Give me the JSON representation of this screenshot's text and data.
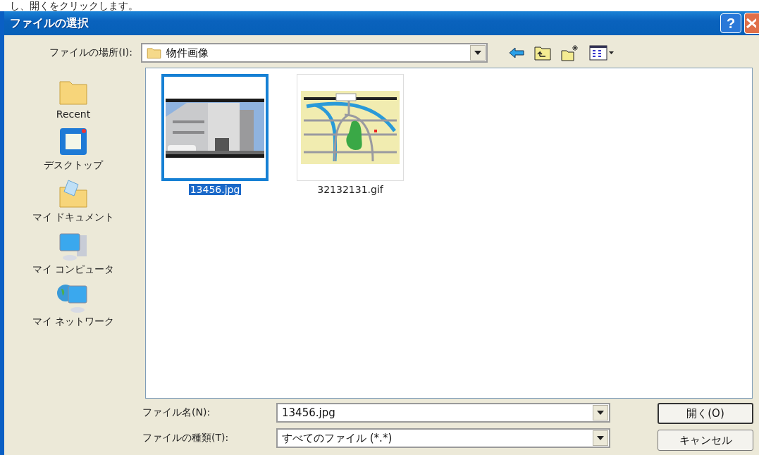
{
  "caption": "し、開くをクリックします。",
  "window": {
    "title": "ファイルの選択",
    "help": "?"
  },
  "location": {
    "label": "ファイルの場所(I):",
    "value": "物件画像"
  },
  "places": [
    {
      "label": "Recent",
      "kind": "recent"
    },
    {
      "label": "デスクトップ",
      "kind": "desktop"
    },
    {
      "label": "マイ ドキュメント",
      "kind": "documents"
    },
    {
      "label": "マイ コンピュータ",
      "kind": "computer"
    },
    {
      "label": "マイ ネットワーク",
      "kind": "network"
    }
  ],
  "files": [
    {
      "name": "13456.jpg",
      "selected": true
    },
    {
      "name": "32132131.gif",
      "selected": false,
      "kind": "map"
    }
  ],
  "fields": [
    {
      "label": "ファイル名(N):",
      "value": "13456.jpg"
    },
    {
      "label": "ファイルの種類(T):",
      "value": "すべてのファイル (*.*)"
    }
  ],
  "buttons": [
    "開く(O)",
    "キャンセル"
  ]
}
